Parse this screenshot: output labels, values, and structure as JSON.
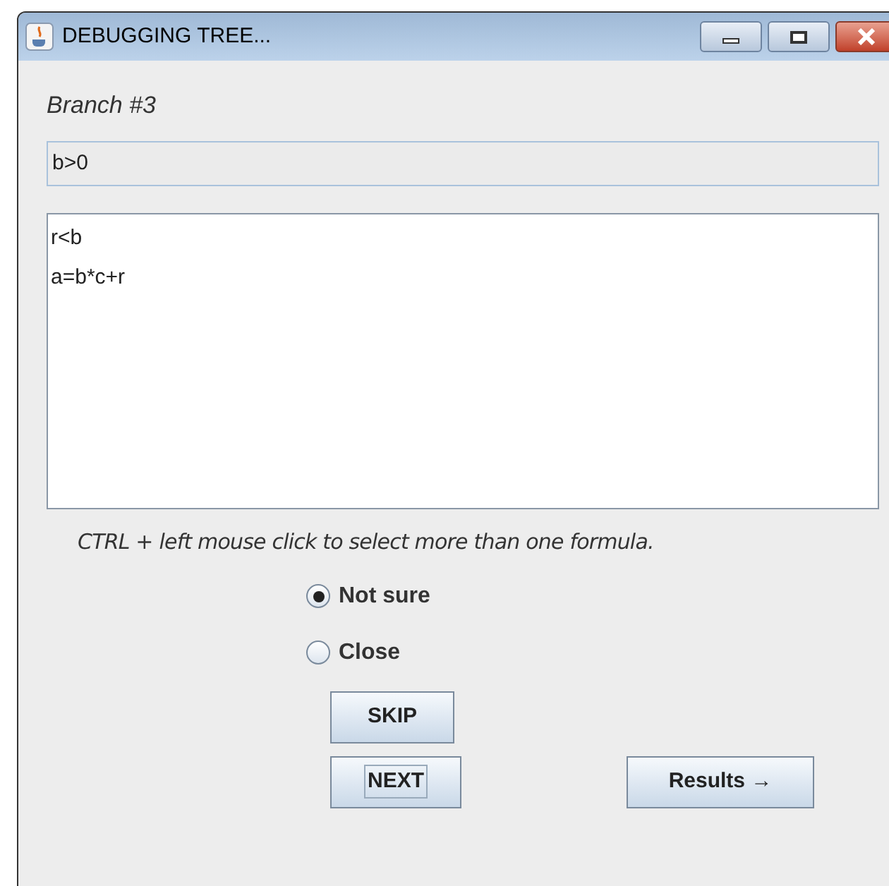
{
  "window": {
    "title": "DEBUGGING TREE..."
  },
  "branch_label": "Branch #3",
  "condition_field": {
    "value": "b>0"
  },
  "formulas": [
    {
      "text": "r<b",
      "selected": false
    },
    {
      "text": "a=b*c+r",
      "selected": false
    }
  ],
  "hint": "CTRL + left mouse click to select more than one formula.",
  "options": [
    {
      "label": "Not sure",
      "selected": true
    },
    {
      "label": "Close",
      "selected": false
    }
  ],
  "buttons": {
    "skip": "SKIP",
    "next": "NEXT",
    "results": "Results →"
  }
}
